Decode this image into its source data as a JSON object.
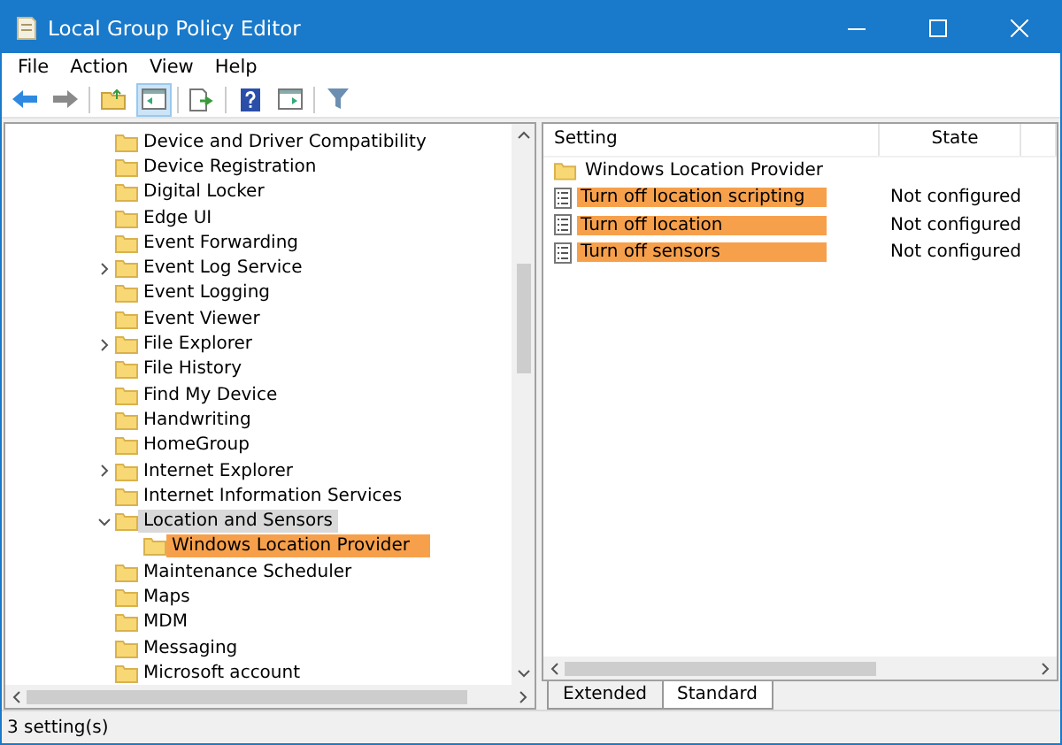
{
  "window": {
    "title": "Local Group Policy Editor"
  },
  "menu": [
    "File",
    "Action",
    "View",
    "Help"
  ],
  "toolbar": [
    {
      "kind": "back",
      "pressed": false
    },
    {
      "kind": "forward",
      "pressed": false
    },
    {
      "kind": "sep"
    },
    {
      "kind": "up",
      "pressed": false
    },
    {
      "kind": "tree",
      "pressed": true
    },
    {
      "kind": "sep"
    },
    {
      "kind": "export",
      "pressed": false
    },
    {
      "kind": "sep"
    },
    {
      "kind": "help",
      "pressed": false
    },
    {
      "kind": "pane",
      "pressed": false
    },
    {
      "kind": "sep"
    },
    {
      "kind": "filter",
      "pressed": false
    }
  ],
  "tree": [
    {
      "label": "Device and Driver Compatibility",
      "kind": "leaf",
      "selected": false,
      "highlighted": false
    },
    {
      "label": "Device Registration",
      "kind": "leaf",
      "selected": false,
      "highlighted": false
    },
    {
      "label": "Digital Locker",
      "kind": "leaf",
      "selected": false,
      "highlighted": false
    },
    {
      "label": "Edge UI",
      "kind": "leaf",
      "selected": false,
      "highlighted": false
    },
    {
      "label": "Event Forwarding",
      "kind": "leaf",
      "selected": false,
      "highlighted": false
    },
    {
      "label": "Event Log Service",
      "kind": "branch",
      "expanded": false,
      "selected": false,
      "highlighted": false
    },
    {
      "label": "Event Logging",
      "kind": "leaf",
      "selected": false,
      "highlighted": false
    },
    {
      "label": "Event Viewer",
      "kind": "leaf",
      "selected": false,
      "highlighted": false
    },
    {
      "label": "File Explorer",
      "kind": "branch",
      "expanded": false,
      "selected": false,
      "highlighted": false
    },
    {
      "label": "File History",
      "kind": "leaf",
      "selected": false,
      "highlighted": false
    },
    {
      "label": "Find My Device",
      "kind": "leaf",
      "selected": false,
      "highlighted": false
    },
    {
      "label": "Handwriting",
      "kind": "leaf",
      "selected": false,
      "highlighted": false
    },
    {
      "label": "HomeGroup",
      "kind": "leaf",
      "selected": false,
      "highlighted": false
    },
    {
      "label": "Internet Explorer",
      "kind": "branch",
      "expanded": false,
      "selected": false,
      "highlighted": false
    },
    {
      "label": "Internet Information Services",
      "kind": "leaf",
      "selected": false,
      "highlighted": false
    },
    {
      "label": "Location and Sensors",
      "kind": "branch",
      "expanded": true,
      "selected": true,
      "highlighted": false,
      "children": [
        {
          "label": "Windows Location Provider",
          "selected": false,
          "highlighted": true
        }
      ]
    },
    {
      "label": "Maintenance Scheduler",
      "kind": "leaf",
      "selected": false,
      "highlighted": false
    },
    {
      "label": "Maps",
      "kind": "leaf",
      "selected": false,
      "highlighted": false
    },
    {
      "label": "MDM",
      "kind": "leaf",
      "selected": false,
      "highlighted": false
    },
    {
      "label": "Messaging",
      "kind": "leaf",
      "selected": false,
      "highlighted": false
    },
    {
      "label": "Microsoft account",
      "kind": "leaf",
      "selected": false,
      "highlighted": false
    }
  ],
  "table": {
    "columns": [
      "Setting",
      "State"
    ],
    "rows": [
      {
        "kind": "folder",
        "name": "Windows Location Provider",
        "highlighted": false
      },
      {
        "kind": "policy",
        "name": "Turn off location scripting",
        "state": "Not configured",
        "highlighted": true
      },
      {
        "kind": "policy",
        "name": "Turn off location",
        "state": "Not configured",
        "highlighted": true
      },
      {
        "kind": "policy",
        "name": "Turn off sensors",
        "state": "Not configured",
        "highlighted": true
      }
    ]
  },
  "tabs": [
    {
      "label": "Extended",
      "selected": false
    },
    {
      "label": "Standard",
      "selected": true
    }
  ],
  "status_bar": "3 setting(s)"
}
